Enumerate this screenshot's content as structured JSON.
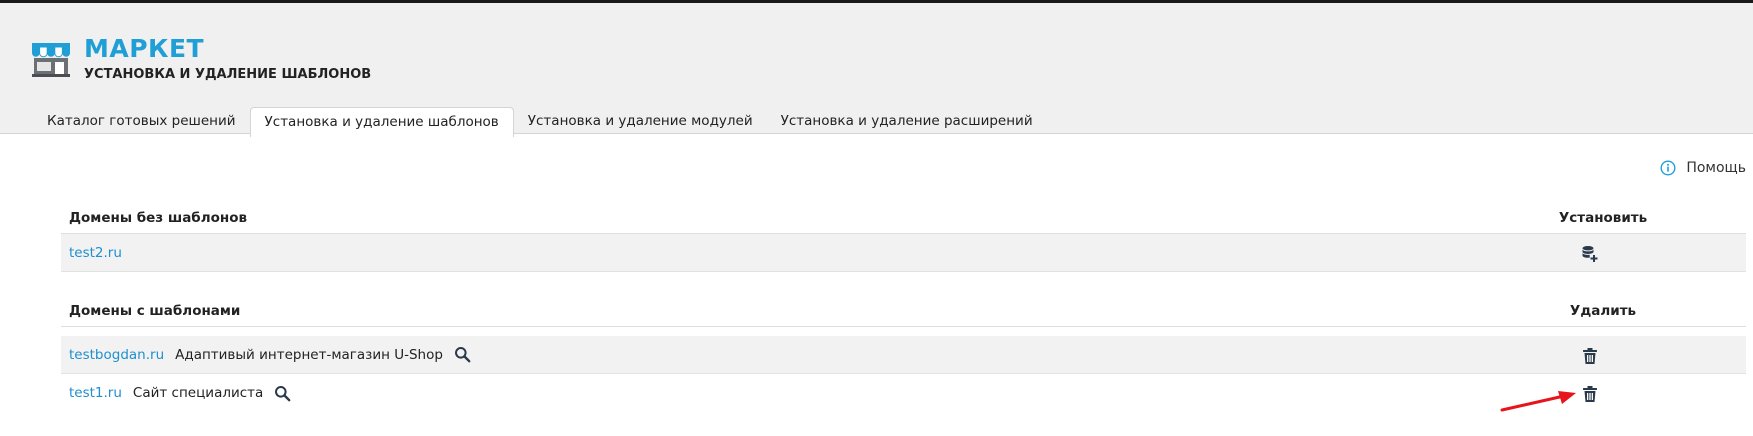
{
  "header": {
    "title": "МАРКЕТ",
    "subtitle": "УСТАНОВКА И УДАЛЕНИЕ ШАБЛОНОВ"
  },
  "tabs": [
    {
      "label": "Каталог готовых решений",
      "active": false
    },
    {
      "label": "Установка и удаление шаблонов",
      "active": true
    },
    {
      "label": "Установка и удаление модулей",
      "active": false
    },
    {
      "label": "Установка и удаление расширений",
      "active": false
    }
  ],
  "help": {
    "label": "Помощь",
    "icon": "info-icon"
  },
  "sections": {
    "without_templates": {
      "heading": "Домены без шаблонов",
      "action_heading": "Установить",
      "rows": [
        {
          "domain": "test2.ru",
          "action_icon": "database-add-icon"
        }
      ]
    },
    "with_templates": {
      "heading": "Домены с шаблонами",
      "action_heading": "Удалить",
      "rows": [
        {
          "domain": "testbogdan.ru",
          "template": "Адаптивый интернет-магазин U-Shop",
          "action_icon": "trash-icon"
        },
        {
          "domain": "test1.ru",
          "template": "Сайт специалиста",
          "action_icon": "trash-icon"
        }
      ]
    }
  },
  "colors": {
    "accent": "#1f9fd6",
    "link": "#1f8fcf",
    "header_bg": "#f0f0f0",
    "row_bg": "#f2f2f2",
    "arrow": "#e8141c"
  }
}
